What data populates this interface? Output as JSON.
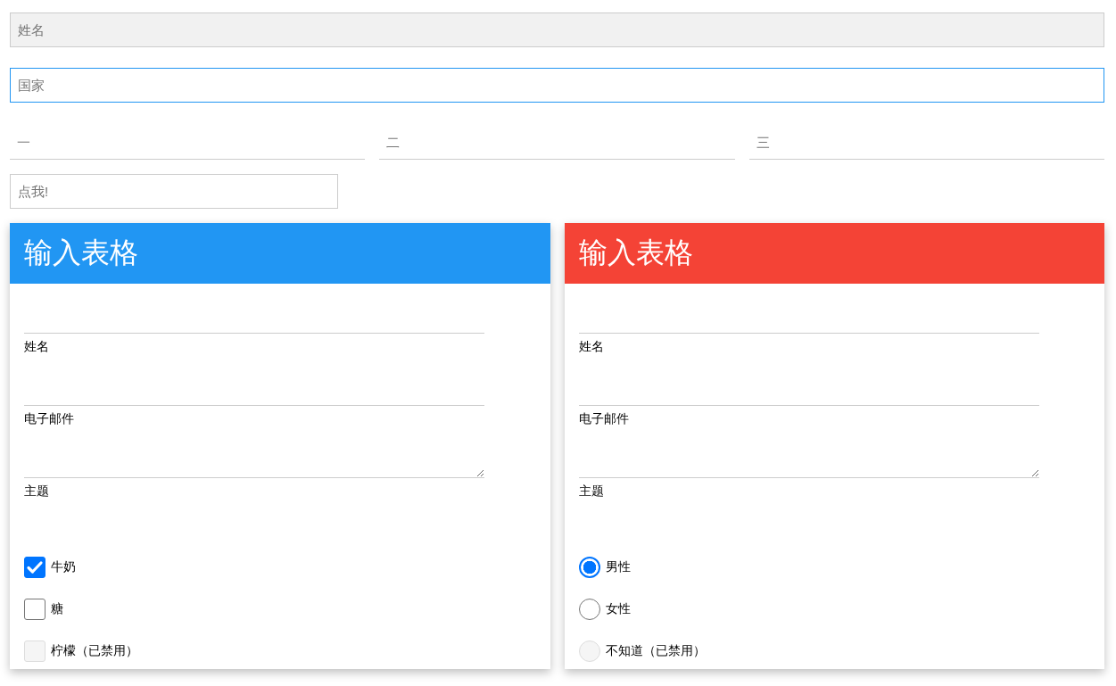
{
  "top_fields": [
    {
      "kind": "filled",
      "placeholder": "姓名"
    },
    {
      "kind": "focused",
      "placeholder": "国家"
    }
  ],
  "row_fields": [
    {
      "placeholder": "一"
    },
    {
      "placeholder": "二"
    },
    {
      "placeholder": "三"
    }
  ],
  "short_field": {
    "placeholder": "点我!"
  },
  "cards": [
    {
      "title": "输入表格",
      "color": "#2196f3",
      "fields": [
        {
          "kind": "input",
          "label": "姓名"
        },
        {
          "kind": "input",
          "label": "电子邮件"
        },
        {
          "kind": "textarea",
          "label": "主题"
        }
      ],
      "options": [
        {
          "kind": "checkbox",
          "label": "牛奶",
          "checked": true,
          "disabled": false
        },
        {
          "kind": "checkbox",
          "label": "糖",
          "checked": false,
          "disabled": false
        },
        {
          "kind": "checkbox",
          "label": "柠檬（已禁用）",
          "checked": false,
          "disabled": true
        }
      ]
    },
    {
      "title": "输入表格",
      "color": "#f44336",
      "fields": [
        {
          "kind": "input",
          "label": "姓名"
        },
        {
          "kind": "input",
          "label": "电子邮件"
        },
        {
          "kind": "textarea",
          "label": "主题"
        }
      ],
      "options": [
        {
          "kind": "radio",
          "label": "男性",
          "selected": true,
          "disabled": false
        },
        {
          "kind": "radio",
          "label": "女性",
          "selected": false,
          "disabled": false
        },
        {
          "kind": "radio",
          "label": "不知道（已禁用）",
          "selected": false,
          "disabled": true
        }
      ]
    }
  ]
}
